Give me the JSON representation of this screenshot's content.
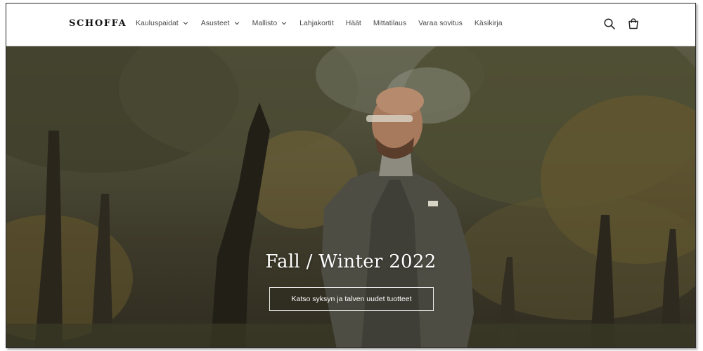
{
  "header": {
    "logo": "SCHOFFA",
    "nav": [
      {
        "label": "Kauluspaidat",
        "dropdown": true
      },
      {
        "label": "Asusteet",
        "dropdown": true
      },
      {
        "label": "Mallisto",
        "dropdown": true
      },
      {
        "label": "Lahjakortit",
        "dropdown": false
      },
      {
        "label": "Häät",
        "dropdown": false
      },
      {
        "label": "Mittatilaus",
        "dropdown": false
      },
      {
        "label": "Varaa sovitus",
        "dropdown": false
      },
      {
        "label": "Käsikirja",
        "dropdown": false
      }
    ],
    "icons": [
      "search-icon",
      "cart-icon"
    ]
  },
  "hero": {
    "title": "Fall / Winter 2022",
    "button_label": "Katso syksyn ja talven uudet tuotteet"
  },
  "colors": {
    "header_bg": "#ffffff",
    "text": "#121212",
    "hero_text": "#ffffff"
  }
}
